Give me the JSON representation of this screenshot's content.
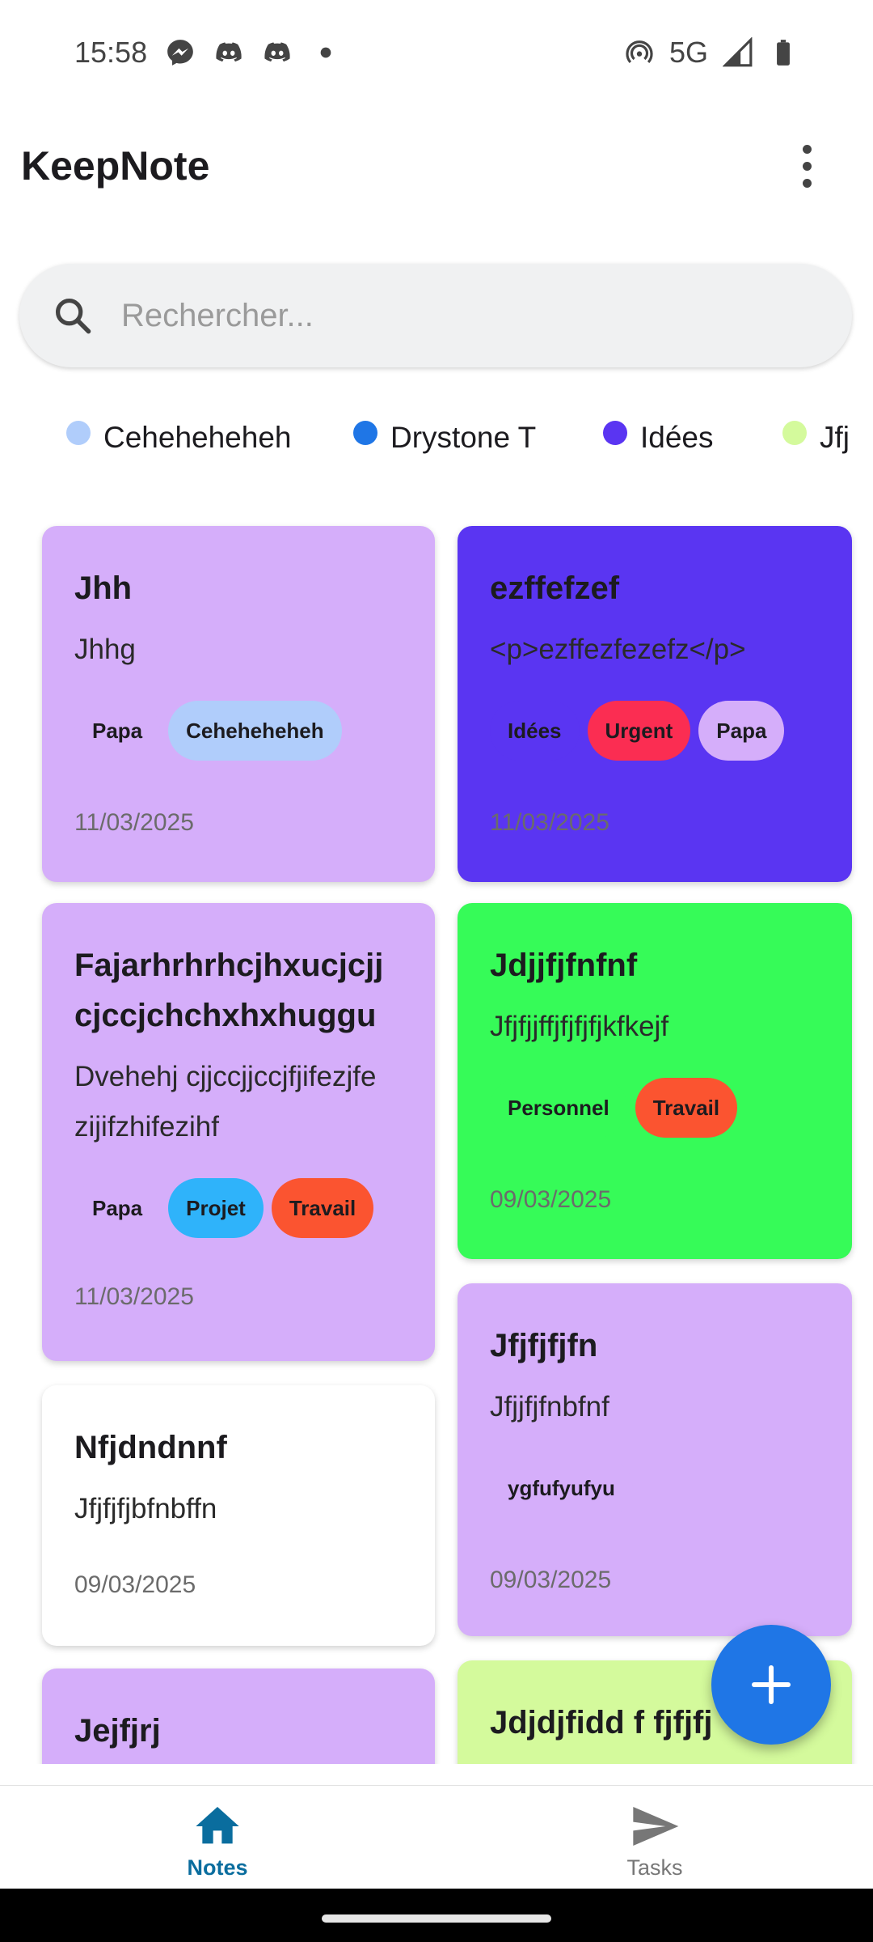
{
  "status_bar": {
    "time": "15:58",
    "network": "5G",
    "icons": [
      "messenger-icon",
      "discord-icon",
      "discord-icon",
      "dot-icon",
      "hotspot-icon",
      "signal-icon",
      "battery-icon"
    ]
  },
  "app": {
    "title": "KeepNote",
    "menu_icon": "more-vert-icon"
  },
  "search": {
    "placeholder": "Rechercher...",
    "value": ""
  },
  "categories": [
    {
      "label": "Ceheheheheh",
      "color": "#b0cdfb"
    },
    {
      "label": "Drystone T",
      "color": "#1f76e6"
    },
    {
      "label": "Idées",
      "color": "#5a35f2"
    },
    {
      "label": "Jfj",
      "color": "#d4fa9c"
    }
  ],
  "notes": [
    {
      "title": "Jhh",
      "body": "Jhhg",
      "date": "11/03/2025",
      "color": "#d5aefa",
      "tags": [
        {
          "label": "Papa",
          "color": "#d5aefa"
        },
        {
          "label": "Ceheheheheh",
          "color": "#b0cdfb"
        }
      ]
    },
    {
      "title": "ezffefzef",
      "body": "<p>ezffezfezefz</p>",
      "date": "11/03/2025",
      "color": "#5a35f2",
      "tags": [
        {
          "label": "Idées",
          "color": "#5a35f2"
        },
        {
          "label": "Urgent",
          "color": "#fb2d52"
        },
        {
          "label": "Papa",
          "color": "#d5aefa"
        }
      ]
    },
    {
      "title_lines": [
        "Fajarhrhrhcjhxucjcjj",
        "cjccjchchxhxhuggu"
      ],
      "body_lines": [
        "Dvehehj cjjccjjccjfjifezjfe",
        "zijifzhifezihf"
      ],
      "date": "11/03/2025",
      "color": "#d5aefa",
      "tags": [
        {
          "label": "Papa",
          "color": "#d5aefa"
        },
        {
          "label": "Projet",
          "color": "#2fb3fa"
        },
        {
          "label": "Travail",
          "color": "#fb5430"
        }
      ]
    },
    {
      "title": "Jdjjfjfnfnf",
      "body": "Jfjfjjffjfjfjfjkfkejf",
      "date": "09/03/2025",
      "color": "#36fb58",
      "tags": [
        {
          "label": "Personnel",
          "color": "#36fb58"
        },
        {
          "label": "Travail",
          "color": "#fb5430"
        }
      ]
    },
    {
      "title": "Nfjdndnnf",
      "body": "Jfjfjfjbfnbffn",
      "date": "09/03/2025",
      "color": "#ffffff",
      "tags": []
    },
    {
      "title": "Jfjfjfjfn",
      "body": "Jfjjfjfnbfnf",
      "date": "09/03/2025",
      "color": "#d5aefa",
      "tags": [
        {
          "label": "ygfufyufyu",
          "color": "#d5aefa"
        }
      ]
    },
    {
      "title": "Jejfjrj",
      "color": "#d5aefa"
    },
    {
      "title": "Jdjdjfidd f fjfjfj",
      "color": "#d4fa9c"
    }
  ],
  "fab": {
    "icon": "plus-icon",
    "color": "#1f76e6"
  },
  "bottom_nav": [
    {
      "label": "Notes",
      "icon": "home-icon",
      "active": true,
      "color": "#0a6d9e"
    },
    {
      "label": "Tasks",
      "icon": "send-icon",
      "active": false,
      "color": "#777777"
    }
  ]
}
